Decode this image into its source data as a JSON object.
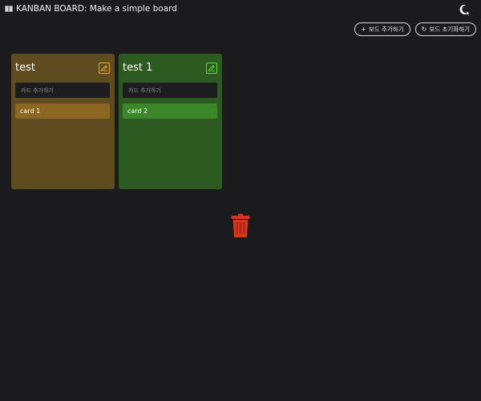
{
  "header": {
    "icon": "open-book-icon",
    "title": "KANBAN BOARD: Make a simple board"
  },
  "theme_toggle": {
    "icon": "moon-icon"
  },
  "toolbar": {
    "add_board_label": "보드 추가하기",
    "add_board_icon": "+",
    "reset_board_label": "보드 초기화하기",
    "reset_board_icon": "↻"
  },
  "colors": {
    "background": "#1b1a1d",
    "board_1_bg": "#5f4b20",
    "board_1_card": "#8c6722",
    "board_1_accent": "#e8a52e",
    "board_2_bg": "#2d5a20",
    "board_2_card": "#3b8729",
    "board_2_accent": "#5edf36",
    "trash": "#d7351c"
  },
  "boards": [
    {
      "title": "test",
      "input_placeholder": "카드 추가하기",
      "cards": [
        "card 1"
      ]
    },
    {
      "title": "test 1",
      "input_placeholder": "카드 추가하기",
      "cards": [
        "card 2"
      ]
    }
  ],
  "trash": {
    "icon": "trash-icon"
  }
}
